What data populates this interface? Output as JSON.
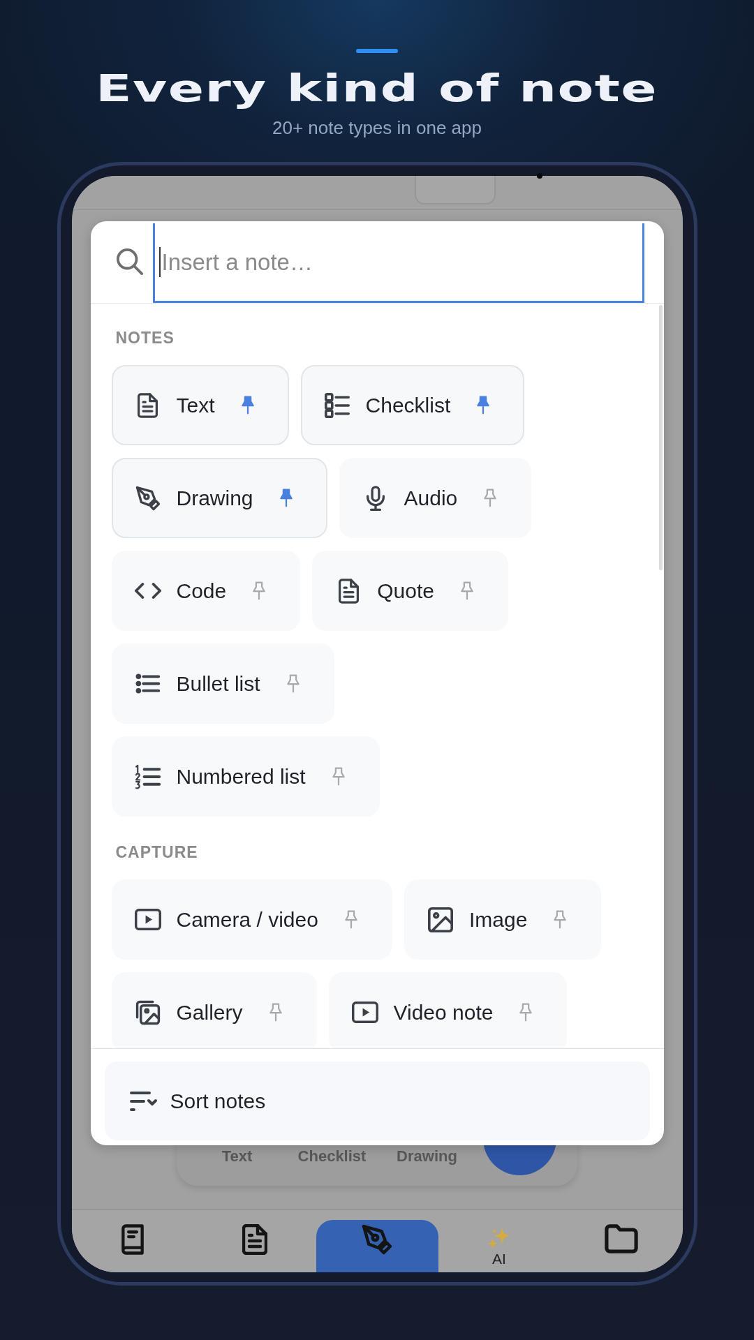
{
  "header": {
    "title": "Every kind of note",
    "subtitle": "20+ note types in one app"
  },
  "search": {
    "placeholder": "Insert a note…",
    "focused": true
  },
  "sections": [
    {
      "label": "NOTES",
      "items": [
        {
          "label": "Text",
          "pinned": true
        },
        {
          "label": "Checklist",
          "pinned": true
        },
        {
          "label": "Drawing",
          "pinned": true
        },
        {
          "label": "Audio",
          "pinned": false
        },
        {
          "label": "Code",
          "pinned": false
        },
        {
          "label": "Quote",
          "pinned": false
        },
        {
          "label": "Bullet list",
          "pinned": false
        },
        {
          "label": "Numbered list",
          "pinned": false
        }
      ]
    },
    {
      "label": "CAPTURE",
      "items": [
        {
          "label": "Camera / video",
          "pinned": false
        },
        {
          "label": "Image",
          "pinned": false
        },
        {
          "label": "Gallery",
          "pinned": false
        },
        {
          "label": "Video note",
          "pinned": false
        }
      ]
    }
  ],
  "footer": {
    "sort_button": "Sort notes"
  },
  "quick_bar": {
    "items": [
      "Text",
      "Checklist",
      "Drawing"
    ]
  },
  "bottom_nav": [
    {
      "selected": false
    },
    {
      "selected": false
    },
    {
      "selected": true
    },
    {
      "label": "AI",
      "selected": false
    },
    {
      "selected": false
    }
  ]
}
